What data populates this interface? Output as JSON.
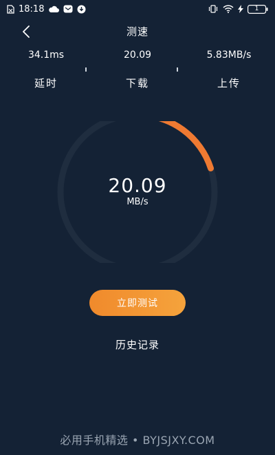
{
  "status_bar": {
    "time": "18:18",
    "battery": "1"
  },
  "header": {
    "title": "测速"
  },
  "metrics": {
    "latency": {
      "value": "34.1ms",
      "label": "延时"
    },
    "download": {
      "value": "20.09",
      "label": "下载"
    },
    "upload": {
      "value": "5.83MB/s",
      "label": "上传"
    }
  },
  "gauge": {
    "value": "20.09",
    "unit": "MB/s",
    "progress_fraction": 0.2,
    "track_color": "#1f2d3f",
    "fill_color": "#ef7a32"
  },
  "actions": {
    "start_label": "立即测试",
    "history_label": "历史记录"
  },
  "watermark": {
    "text": "必用手机精选 • BYJSJXY.COM"
  },
  "colors": {
    "background": "#142235",
    "accent": "#f08a2c"
  }
}
